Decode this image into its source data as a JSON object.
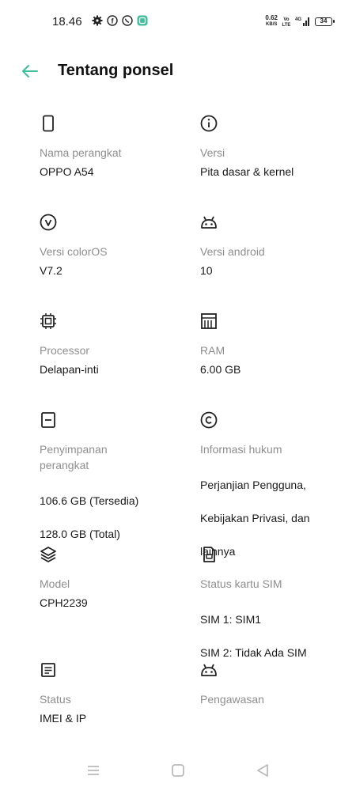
{
  "status_bar": {
    "time": "18.46",
    "net_speed_value": "0.62",
    "net_speed_unit": "KB/S",
    "battery": "34"
  },
  "header": {
    "title": "Tentang ponsel"
  },
  "items": [
    {
      "icon": "phone-icon",
      "label": "Nama perangkat",
      "value": "OPPO A54"
    },
    {
      "icon": "info-icon",
      "label": "Versi",
      "value": "Pita dasar & kernel"
    },
    {
      "icon": "coloros-icon",
      "label": "Versi colorOS",
      "value": "V7.2"
    },
    {
      "icon": "android-icon",
      "label": "Versi android",
      "value": "10"
    },
    {
      "icon": "processor-icon",
      "label": "Processor",
      "value": "Delapan-inti"
    },
    {
      "icon": "ram-icon",
      "label": "RAM",
      "value": "6.00 GB"
    },
    {
      "icon": "storage-icon",
      "label": "Penyimpanan perangkat",
      "value_lines": [
        "106.6 GB (Tersedia)",
        "128.0 GB (Total)"
      ]
    },
    {
      "icon": "copyright-icon",
      "label": "Informasi hukum",
      "value_lines": [
        "Perjanjian Pengguna,",
        "Kebijakan Privasi, dan",
        "lainnya"
      ]
    },
    {
      "icon": "layers-icon",
      "label": "Model",
      "value": "CPH2239"
    },
    {
      "icon": "sim-card-icon",
      "label": "Status kartu SIM",
      "value_lines": [
        "SIM 1: SIM1",
        "SIM 2: Tidak Ada SIM"
      ]
    },
    {
      "icon": "document-icon",
      "label": "Status",
      "value": "IMEI & IP"
    },
    {
      "icon": "android-icon",
      "label": "Pengawasan",
      "value": ""
    }
  ],
  "colors": {
    "accent": "#3fbf9b",
    "label": "#8e8e8e",
    "text": "#1a1a1a"
  }
}
